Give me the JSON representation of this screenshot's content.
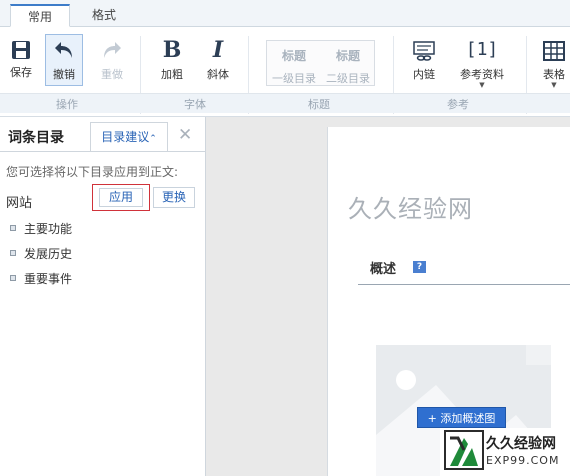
{
  "ribbon": {
    "tabs": [
      {
        "label": "常用"
      },
      {
        "label": "格式"
      }
    ],
    "buttons": {
      "save": "保存",
      "undo": "撤销",
      "redo": "重做",
      "bold": "加粗",
      "italic": "斜体",
      "heading1_big": "标题",
      "heading1_small": "一级目录",
      "heading2_big": "标题",
      "heading2_small": "二级目录",
      "inline_link": "内链",
      "reference": "参考资料",
      "reference_badge": "[1]",
      "table": "表格"
    },
    "groups": {
      "operation": "操作",
      "font": "字体",
      "heading": "标题",
      "reference": "参考"
    }
  },
  "panel": {
    "title": "词条目录",
    "tab_label": "目录建议",
    "hint": "您可选择将以下目录应用到正文:",
    "entry_name": "网站",
    "apply_label": "应用",
    "change_label": "更换",
    "toc_items": [
      {
        "label": "主要功能"
      },
      {
        "label": "发展历史"
      },
      {
        "label": "重要事件"
      }
    ]
  },
  "editor": {
    "title": "久久经验网",
    "section_label": "概述",
    "help_mark": "?",
    "add_image_label": "添加概述图"
  },
  "watermark": {
    "name": "久久经验网",
    "domain": "EXP99.COM"
  },
  "colors": {
    "accent": "#2f6fd0",
    "highlight_border": "#d0323a"
  }
}
